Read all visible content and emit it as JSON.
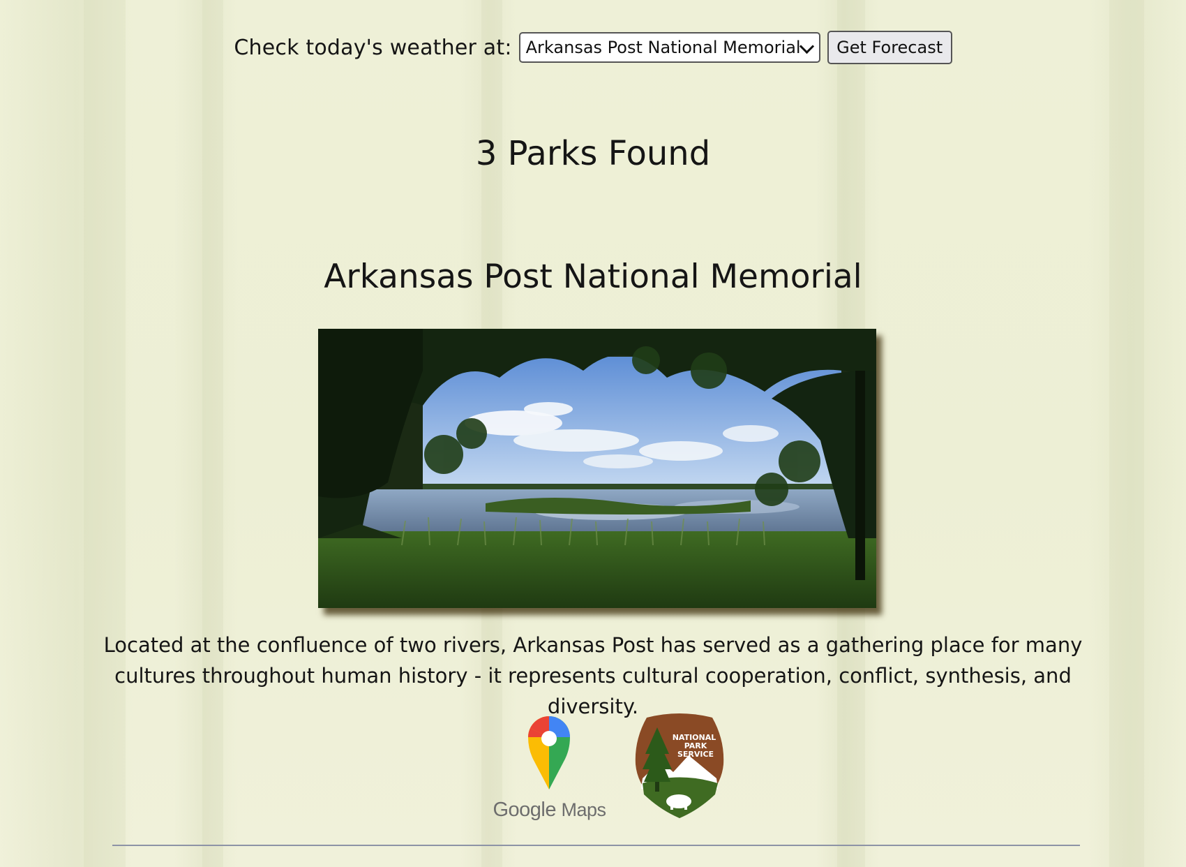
{
  "weather": {
    "label": "Check today's weather at:",
    "selected_park": "Arkansas Post National Memorial",
    "button_label": "Get Forecast"
  },
  "results": {
    "count_text": "3 Parks Found"
  },
  "park": {
    "name": "Arkansas Post National Memorial",
    "description": "Located at the confluence of two rivers, Arkansas Post has served as a gathering place for many cultures throughout human history - it represents cultural cooperation, conflict, synthesis, and diversity.",
    "links": {
      "google_maps": {
        "brand_google": "Google",
        "brand_maps": "Maps",
        "icon": "google-maps-pin-icon"
      },
      "nps": {
        "logo_text": "NATIONAL PARK SERVICE",
        "icon": "nps-arrowhead-icon"
      }
    }
  },
  "colors": {
    "page_background": "#eef0d6",
    "text": "#151515",
    "divider": "#8d93a6",
    "nps_brown": "#8a4a25"
  }
}
